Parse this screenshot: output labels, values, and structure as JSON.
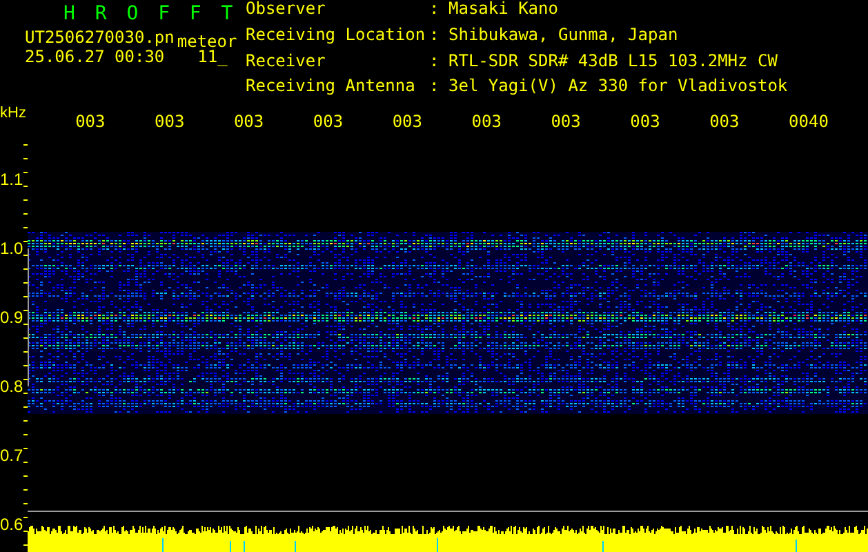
{
  "header": {
    "title": "H R O F F T",
    "filename": "UT2506270030.pn",
    "tag": "meteor",
    "datetime": "25.06.27 00:30",
    "counter": "11_"
  },
  "station": [
    {
      "label": "Observer",
      "colon": ":",
      "value": "Masaki Kano"
    },
    {
      "label": "Receiving Location",
      "colon": ":",
      "value": "Shibukawa, Gunma, Japan"
    },
    {
      "label": "Receiver",
      "colon": ":",
      "value": "RTL-SDR SDR# 43dB L15 103.2MHz CW"
    },
    {
      "label": "Receiving Antenna",
      "colon": ":",
      "value": "3el Yagi(V) Az 330 for Vladivostok"
    }
  ],
  "plot": {
    "unit": "kHz",
    "time_labels": [
      "003",
      "003",
      "003",
      "003",
      "003",
      "003",
      "003",
      "003",
      "003",
      "0040"
    ],
    "freq_labels": [
      "1.1",
      "1.0",
      "0.9",
      "0.8",
      "0.7",
      "0.6"
    ]
  }
}
